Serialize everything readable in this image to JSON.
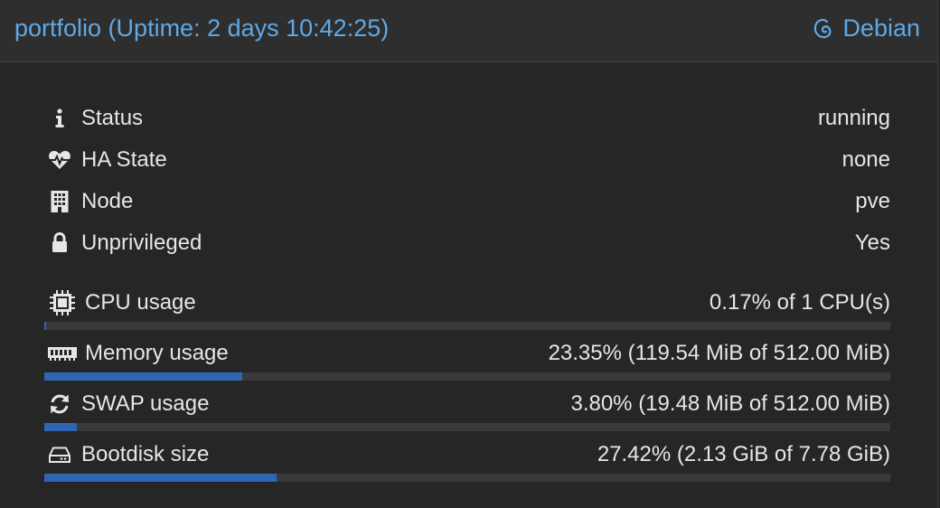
{
  "header": {
    "title": "portfolio (Uptime: 2 days 10:42:25)",
    "os_icon": "debian-swirl-icon",
    "os_name": "Debian"
  },
  "status_rows": [
    {
      "icon": "info-icon",
      "label": "Status",
      "value": "running"
    },
    {
      "icon": "heartbeat-icon",
      "label": "HA State",
      "value": "none"
    },
    {
      "icon": "building-icon",
      "label": "Node",
      "value": "pve"
    },
    {
      "icon": "lock-icon",
      "label": "Unprivileged",
      "value": "Yes"
    }
  ],
  "usage_rows": [
    {
      "icon": "cpu-chip-icon",
      "label": "CPU usage",
      "value": "0.17% of 1 CPU(s)",
      "percent": 0.17
    },
    {
      "icon": "memory-icon",
      "label": "Memory usage",
      "value": "23.35% (119.54 MiB of 512.00 MiB)",
      "percent": 23.35
    },
    {
      "icon": "refresh-icon",
      "label": "SWAP usage",
      "value": "3.80% (19.48 MiB of 512.00 MiB)",
      "percent": 3.8
    },
    {
      "icon": "hdd-icon",
      "label": "Bootdisk size",
      "value": "27.42% (2.13 GiB of 7.78 GiB)",
      "percent": 27.42
    }
  ],
  "colors": {
    "accent": "#5fa8e6",
    "bar_fill": "#2f66b3",
    "bar_track": "#3a3a3a",
    "background": "#262626"
  }
}
